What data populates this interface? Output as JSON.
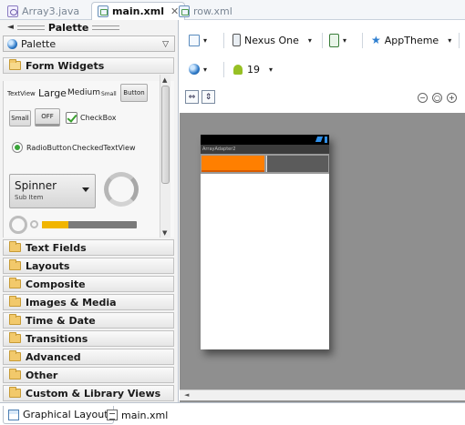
{
  "editor_tabs": [
    {
      "label": "Array3.java",
      "icon": "java-file-icon",
      "active": false
    },
    {
      "label": "main.xml",
      "icon": "xml-layout-file-icon",
      "active": true,
      "close": "✕"
    },
    {
      "label": "row.xml",
      "icon": "xml-layout-file-icon",
      "active": false
    }
  ],
  "palette": {
    "header": "Palette",
    "collapse_arrow": "◄",
    "selector_label": "Palette",
    "selector_caret": "▽",
    "open_section": "Form Widgets",
    "widgets": {
      "textview": "TextView",
      "large": "Large",
      "medium": "Medium",
      "small": "Small",
      "button": "Button",
      "small_button": "Small",
      "toggle_off": "OFF",
      "checkbox": "CheckBox",
      "radiobutton": "RadioButton",
      "checked_textview": "CheckedTextView",
      "spinner_title": "Spinner",
      "spinner_sub": "Sub Item"
    },
    "sections": [
      "Text Fields",
      "Layouts",
      "Composite",
      "Images & Media",
      "Time & Date",
      "Transitions",
      "Advanced",
      "Other",
      "Custom & Library Views"
    ]
  },
  "toolbar": {
    "device": "Nexus One",
    "theme": "AppTheme",
    "api_level": "19",
    "caret": "▾",
    "fit_width": "⇔",
    "fit_height": "⇕",
    "zoom_out": "−",
    "zoom_reset": "○",
    "zoom_in": "+"
  },
  "device_preview": {
    "title": "ArrayAdapter2",
    "tab_colors": {
      "selected": "#ff7f00",
      "unselected": "#5b5b5b"
    }
  },
  "bottom_tabs": [
    {
      "label": "Graphical Layout",
      "active": true
    },
    {
      "label": "main.xml",
      "active": false
    }
  ],
  "colors": {
    "canvas_background": "#8f8f8f",
    "accent_progress": "#f1b500",
    "check_green": "#3a9f2f"
  }
}
